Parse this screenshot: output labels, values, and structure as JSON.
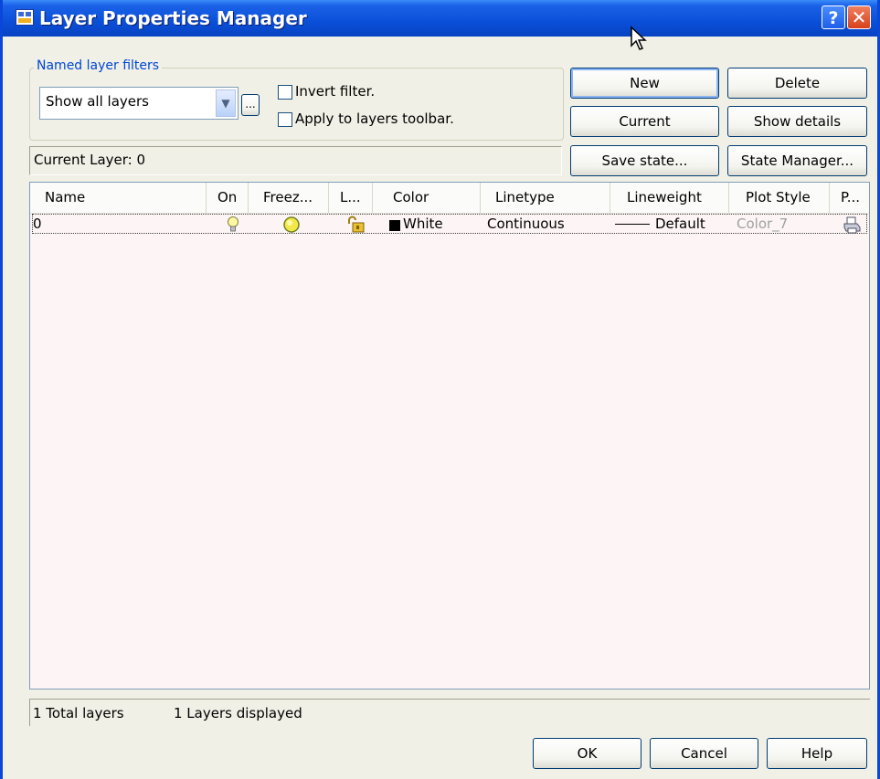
{
  "window": {
    "title": "Layer Properties Manager",
    "help_label": "?",
    "close_label": "✕"
  },
  "filters": {
    "group_label": "Named layer filters",
    "selected_filter": "Show all layers",
    "browse_label": "...",
    "invert_label": "Invert filter.",
    "invert_checked": false,
    "apply_label": "Apply to layers toolbar.",
    "apply_checked": false
  },
  "current_layer": "Current Layer:  0",
  "buttons": {
    "new": "New",
    "delete": "Delete",
    "current": "Current",
    "show_details": "Show details",
    "save_state": "Save state...",
    "state_manager": "State Manager..."
  },
  "columns": [
    "Name",
    "On",
    "Freez...",
    "L...",
    "Color",
    "Linetype",
    "Lineweight",
    "Plot Style",
    "P..."
  ],
  "layers": [
    {
      "name": "0",
      "on_icon": "lightbulb-icon",
      "freeze_icon": "sun-icon",
      "lock_icon": "unlock-icon",
      "color_swatch": "#000000",
      "color": "White",
      "linetype": "Continuous",
      "lineweight": "Default",
      "plot_style": "Color_7",
      "plot_icon": "printer-icon"
    }
  ],
  "status": {
    "total": "1 Total layers",
    "displayed": "1 Layers displayed"
  },
  "footer": {
    "ok": "OK",
    "cancel": "Cancel",
    "help": "Help"
  }
}
